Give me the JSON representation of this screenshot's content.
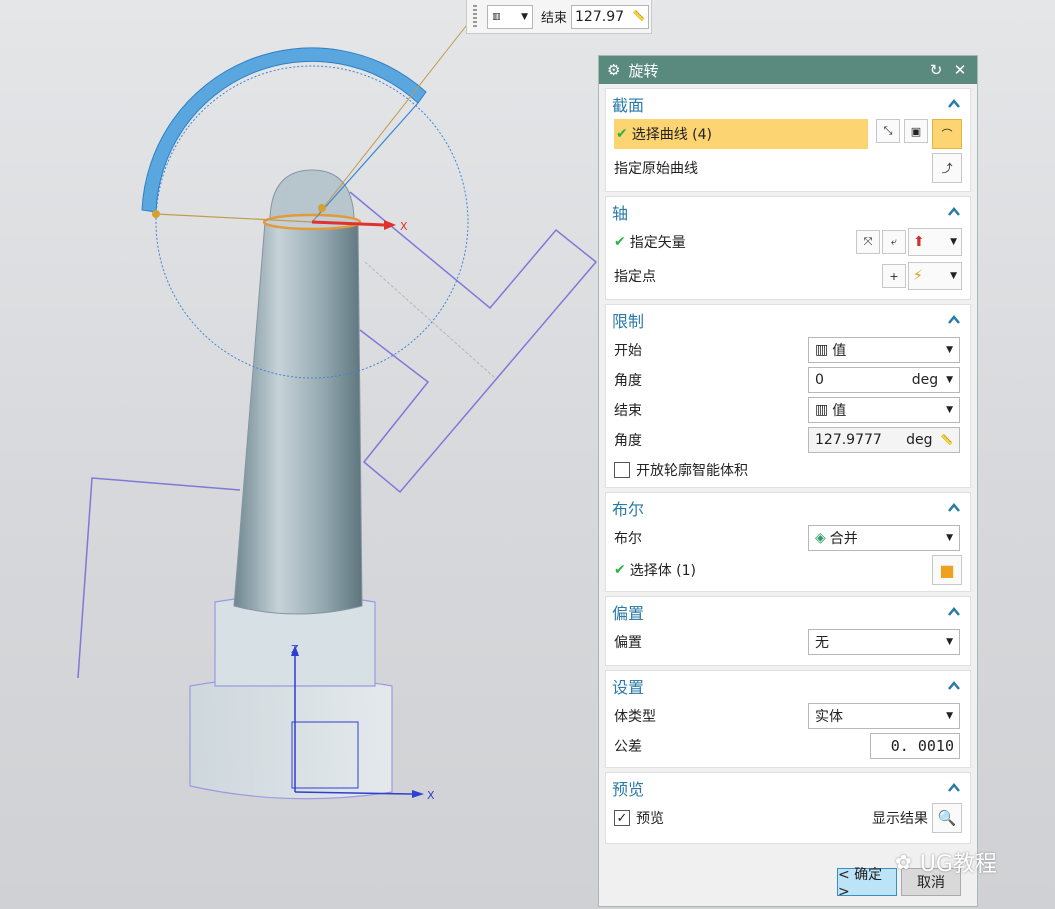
{
  "float_bar": {
    "end_label": "结束",
    "end_value": "127.97"
  },
  "viewport": {
    "axis_x": "X",
    "axis_z": "Z",
    "axis_x_small": "X"
  },
  "dialog": {
    "title": "旋转",
    "section_group": {
      "header": "截面",
      "select_curve": "选择曲线 (4)",
      "specify_origin_curve": "指定原始曲线"
    },
    "axis_group": {
      "header": "轴",
      "specify_vector": "指定矢量",
      "specify_point": "指定点"
    },
    "limits_group": {
      "header": "限制",
      "start_label": "开始",
      "start_value": "值",
      "start_angle_label": "角度",
      "start_angle": "0",
      "end_label": "结束",
      "end_value": "值",
      "end_angle_label": "角度",
      "end_angle": "127.9777",
      "unit": "deg",
      "open_profile": "开放轮廓智能体积"
    },
    "boolean_group": {
      "header": "布尔",
      "boolean_label": "布尔",
      "boolean_value": "合并",
      "select_body": "选择体 (1)"
    },
    "offset_group": {
      "header": "偏置",
      "offset_label": "偏置",
      "offset_value": "无"
    },
    "settings_group": {
      "header": "设置",
      "body_type_label": "体类型",
      "body_type_value": "实体",
      "tolerance_label": "公差",
      "tolerance_value": "0. 0010"
    },
    "preview_group": {
      "header": "预览",
      "preview_label": "预览",
      "show_result": "显示结果"
    },
    "ok_button": "< 确定 >",
    "cancel_button": "取消"
  },
  "watermark": "UG教程",
  "colors": {
    "title_bar": "#5a8a7e",
    "section_header": "#2a7aa8",
    "selected_row": "#fdd472",
    "check_green": "#2fb14a"
  }
}
